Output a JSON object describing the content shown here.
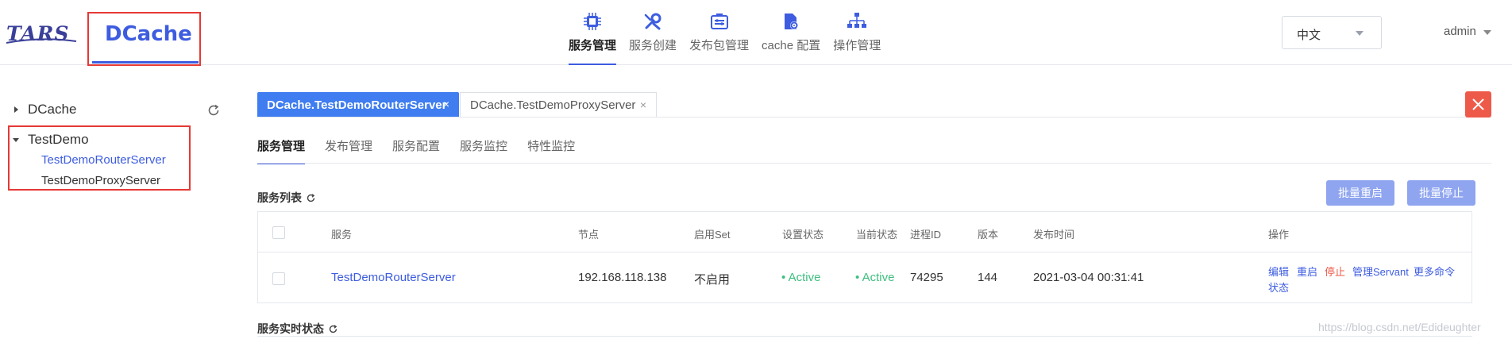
{
  "header": {
    "logos": {
      "tars": "TARS",
      "dcache": "DCache"
    },
    "nav": [
      {
        "label": "服务管理",
        "icon": "chip-icon",
        "active": true
      },
      {
        "label": "服务创建",
        "icon": "wrench-icon",
        "active": false
      },
      {
        "label": "发布包管理",
        "icon": "package-icon",
        "active": false
      },
      {
        "label": "cache 配置",
        "icon": "gear-file-icon",
        "active": false
      },
      {
        "label": "操作管理",
        "icon": "sitemap-icon",
        "active": false
      }
    ],
    "language": {
      "value": "中文"
    },
    "user": {
      "name": "admin"
    }
  },
  "sidebar": {
    "nodes": [
      {
        "label": "DCache",
        "expanded": false
      },
      {
        "label": "TestDemo",
        "expanded": true,
        "children": [
          {
            "label": "TestDemoRouterServer",
            "active": true
          },
          {
            "label": "TestDemoProxyServer",
            "active": false
          }
        ]
      }
    ]
  },
  "tabs": [
    {
      "label": "DCache.TestDemoRouterServer",
      "active": true,
      "close": "×"
    },
    {
      "label": "DCache.TestDemoProxyServer",
      "active": false,
      "close": "×"
    }
  ],
  "subnav": [
    {
      "label": "服务管理",
      "active": true
    },
    {
      "label": "发布管理",
      "active": false
    },
    {
      "label": "服务配置",
      "active": false
    },
    {
      "label": "服务监控",
      "active": false
    },
    {
      "label": "特性监控",
      "active": false
    }
  ],
  "service_list": {
    "title": "服务列表",
    "buttons": {
      "batch_restart": "批量重启",
      "batch_stop": "批量停止"
    },
    "columns": [
      "服务",
      "节点",
      "启用Set",
      "设置状态",
      "当前状态",
      "进程ID",
      "版本",
      "发布时间",
      "操作"
    ],
    "rows": [
      {
        "service": "TestDemoRouterServer",
        "node": "192.168.118.138",
        "set": "不启用",
        "setting_state": "• Active",
        "present_state": "• Active",
        "pid": "74295",
        "version": "144",
        "publish_time": "2021-03-04 00:31:41",
        "ops": {
          "edit": "编辑",
          "restart": "重启",
          "stop": "停止",
          "servant": "管理Servant",
          "more": "更多命令",
          "status": "状态"
        }
      }
    ]
  },
  "realtime": {
    "title": "服务实时状态"
  },
  "watermark": "https://blog.csdn.net/Edideughter",
  "colors": {
    "accent": "#3d5ce0",
    "tab_active": "#3f7df0",
    "success": "#3fbf7f",
    "danger": "#ee5a4a",
    "button_light": "#8fa5f0"
  }
}
